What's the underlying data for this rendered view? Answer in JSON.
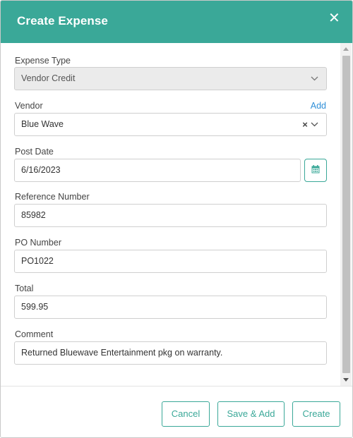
{
  "header": {
    "title": "Create Expense",
    "close_icon": "close-icon"
  },
  "form": {
    "expense_type": {
      "label": "Expense Type",
      "value": "Vendor Credit",
      "disabled": true
    },
    "vendor": {
      "label": "Vendor",
      "add_link": "Add",
      "value": "Blue Wave"
    },
    "post_date": {
      "label": "Post Date",
      "value": "6/16/2023",
      "icon": "calendar-icon"
    },
    "reference_number": {
      "label": "Reference Number",
      "value": "85982"
    },
    "po_number": {
      "label": "PO Number",
      "value": "PO1022"
    },
    "total": {
      "label": "Total",
      "value": "599.95"
    },
    "comment": {
      "label": "Comment",
      "value": "Returned Bluewave Entertainment pkg on warranty."
    }
  },
  "footer": {
    "cancel_label": "Cancel",
    "save_add_label": "Save & Add",
    "create_label": "Create"
  },
  "colors": {
    "accent": "#3aa898",
    "link": "#2f8fd8",
    "disabled_field": "#ebebeb"
  }
}
